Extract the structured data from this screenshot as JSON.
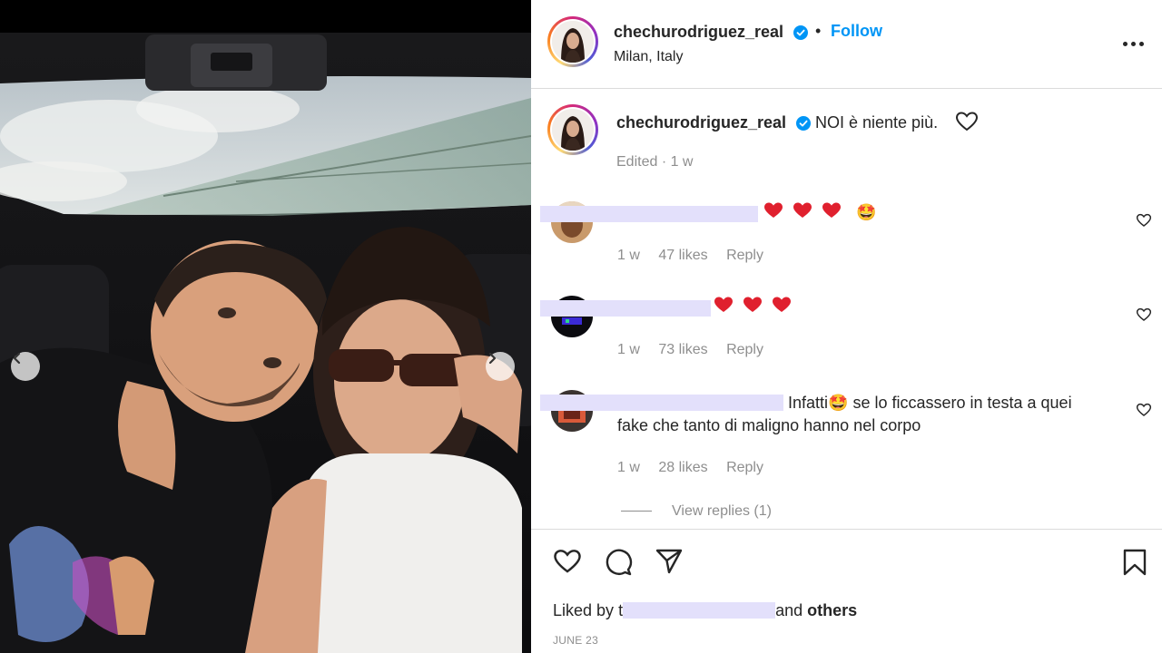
{
  "post": {
    "username": "chechurodriguez_real",
    "follow_label": "Follow",
    "dot": "•",
    "location": "Milan, Italy"
  },
  "caption": {
    "username": "chechurodriguez_real",
    "text": "NOI è niente più.",
    "meta": "Edited · 1 w"
  },
  "comments": [
    {
      "text": "",
      "heart_count": 3,
      "extra_emoji": "🤩",
      "time": "1 w",
      "likes": "47 likes",
      "reply": "Reply"
    },
    {
      "text": "",
      "heart_count": 3,
      "time": "1 w",
      "likes": "73 likes",
      "reply": "Reply"
    },
    {
      "text_line1": "Infatti🤩 se lo ficcassero in testa a quei",
      "text_line2": "fake che tanto di maligno hanno nel corpo",
      "time": "1 w",
      "likes": "28 likes",
      "reply": "Reply"
    }
  ],
  "view_replies": "View replies (1)",
  "footer": {
    "liked_by_prefix": "Liked by",
    "liked_by_first": "t",
    "liked_by_and": "and",
    "liked_by_others": "others",
    "date": "JUNE 23"
  },
  "icons": {
    "heart": "heart-icon",
    "comment": "comment-icon",
    "share": "share-icon",
    "save": "bookmark-icon",
    "more": "more-icon",
    "verified": "verified-badge-icon"
  },
  "colors": {
    "follow": "#0095f6",
    "verified": "#0095f6",
    "redaction": "#e3e0fb",
    "emoji_heart": "#e0202e"
  }
}
